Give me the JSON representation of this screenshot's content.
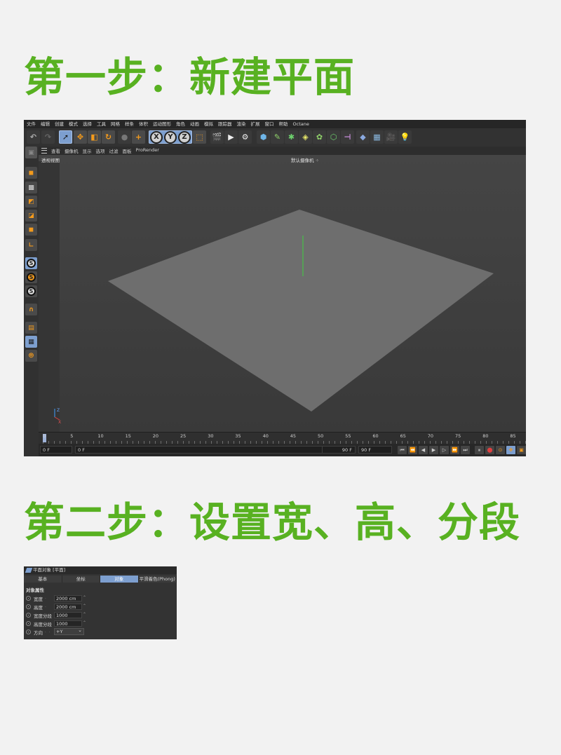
{
  "headings": {
    "step1": "第一步：新建平面",
    "step2": "第二步：设置宽、高、分段"
  },
  "c4d": {
    "menu": [
      "文件",
      "编辑",
      "创建",
      "模式",
      "选择",
      "工具",
      "网格",
      "样条",
      "体积",
      "运动图形",
      "角色",
      "动画",
      "模拟",
      "跟踪器",
      "渲染",
      "扩展",
      "窗口",
      "帮助",
      "Octane"
    ],
    "viewport_menu": [
      "查看",
      "摄像机",
      "显示",
      "选项",
      "过滤",
      "面板",
      "ProRender"
    ],
    "viewport_label": "透视视图",
    "camera_label": "默认摄像机 ⁘",
    "axis_buttons": [
      "X",
      "Y",
      "Z"
    ],
    "left_s_buttons": [
      "S",
      "S",
      "S"
    ],
    "timeline_ticks": [
      "0",
      "5",
      "10",
      "15",
      "20",
      "25",
      "30",
      "35",
      "40",
      "45",
      "50",
      "55",
      "60",
      "65",
      "70",
      "75",
      "80",
      "85"
    ],
    "transport": {
      "current_frame": "0 F",
      "start_frame": "0 F",
      "end_frame": "90 F",
      "end_frame2": "90 F"
    },
    "axis_gizmo": {
      "z": "Z",
      "x": "X"
    }
  },
  "attributes": {
    "title": "平面对象 [平面]",
    "tabs": [
      "基本",
      "坐标",
      "对象",
      "平滑着色(Phong)"
    ],
    "active_tab": "对象",
    "section": "对象属性",
    "props": [
      {
        "label": "宽度",
        "value": "2000 cm"
      },
      {
        "label": "高度",
        "value": "2000 cm"
      },
      {
        "label": "宽度分段",
        "value": "1000"
      },
      {
        "label": "高度分段",
        "value": "1000"
      }
    ],
    "direction": {
      "label": "方向",
      "value": "+Y"
    }
  },
  "colors": {
    "accent_green": "#58b121",
    "c4d_blue": "#7d9fcf",
    "c4d_orange": "#f39a1c"
  }
}
